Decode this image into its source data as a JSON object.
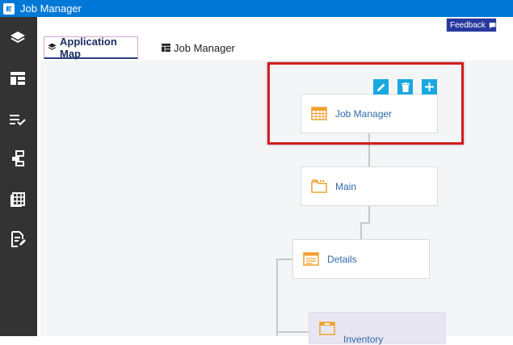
{
  "window": {
    "title": "Job Manager"
  },
  "sidebar": {
    "items": [
      {
        "icon": "layers-icon"
      },
      {
        "icon": "layout-icon"
      },
      {
        "icon": "checklist-icon"
      },
      {
        "icon": "flow-icon"
      },
      {
        "icon": "grid-icon"
      },
      {
        "icon": "edit-doc-icon"
      }
    ]
  },
  "header": {
    "feedback_label": "Feedback"
  },
  "tabs": [
    {
      "label": "Application Map",
      "active": true
    },
    {
      "label": "Job Manager",
      "active": false
    }
  ],
  "map": {
    "nodes": [
      {
        "label": "Job Manager",
        "icon": "table-icon"
      },
      {
        "label": "Main",
        "icon": "folder-icon"
      },
      {
        "label": "Details",
        "icon": "form-icon"
      },
      {
        "label": "Inventory",
        "icon": "form-icon"
      }
    ],
    "actions": [
      {
        "icon": "pencil-icon"
      },
      {
        "icon": "trash-icon"
      },
      {
        "icon": "plus-icon"
      }
    ]
  },
  "colors": {
    "accent": "#0078d7",
    "sidebar": "#333333",
    "selection": "#d41c1c",
    "action": "#1aa8e0",
    "node_icon": "#f0a030"
  }
}
